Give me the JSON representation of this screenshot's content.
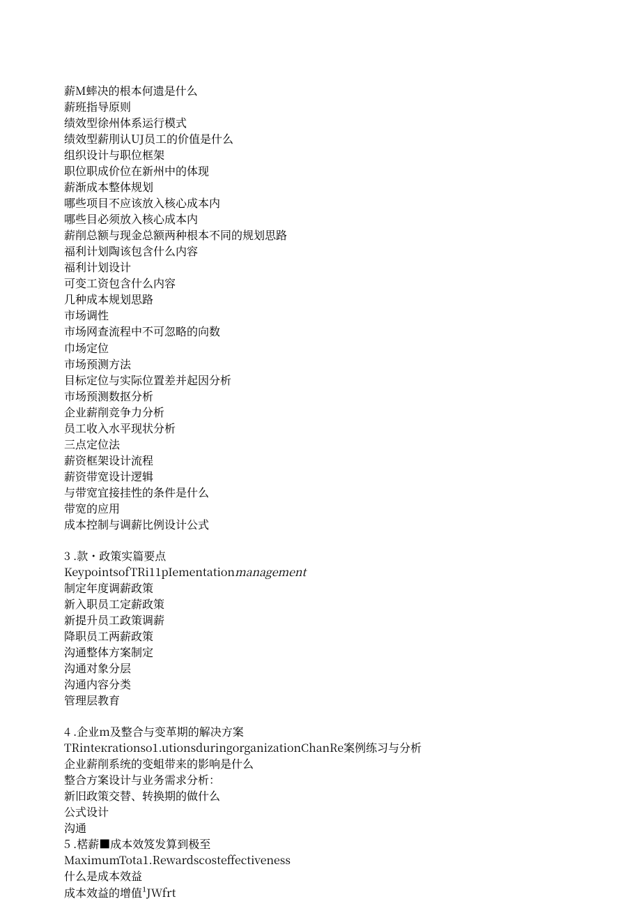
{
  "section1": {
    "lines": [
      "薪M蟀决的根本何遗是什么",
      "薪班指导原则",
      "绩效型徐州体系运行模式",
      "绩效型薪刖认UJ员工的价值是什么",
      "组织设计与职位框架",
      "职位职成价位在新州中的体现",
      "薪渐成本整体规划",
      "哪些项目不应该放入核心成本内",
      "哪些目必须放入核心成本内",
      "薪削总额与现金总额两种根本不同的规划思路",
      "福利计划陶该包含什么内容",
      "福利计划设计",
      "可变工资包含什么内容",
      "几种成本规划思路",
      "市场调性",
      "市场网查流程中不可忽略的向数",
      "巾场定位",
      "市场预测方法",
      "目标定位与实际位置差并起因分析",
      "市场预测数抠分析",
      "企业薪削竞争力分析",
      "员工收入水平现状分析",
      "三点定位法",
      "薪资框架设计流程",
      "薪资带宽设计逻辑",
      "与带宽宜接挂性的条件是什么",
      "带宽的应用",
      "成本控制与调薪比例设计公式"
    ]
  },
  "section3": {
    "heading": "3   .款・政策实篇要点",
    "en_prefix": "KeypointsofTRi11pIementation",
    "en_italic": "management",
    "lines": [
      "制定年度调薪政策",
      "新入职员工定薪政策",
      "新提升员工政策调薪",
      "降职员工两薪政策",
      "沟通整体方案制定",
      "沟通对象分层",
      "沟通内容分类",
      "管理层教育"
    ]
  },
  "section4": {
    "heading": "4   .企业m及整合与变革期的解决方案",
    "lines": [
      "TRinteкrationso1.utionsduringorganizationChanRe案例练习与分析",
      "企业薪削系统的变蛆带来的影响是什么",
      "整合方案设计与业务需求分析：",
      "新旧政策交替、转换期的做什么",
      "公式设计",
      "沟通"
    ]
  },
  "section5": {
    "heading": "5  .楛薪■成本效笈发算到极至",
    "lines": [
      "MaximumTota1.Rewardscosteffectiveness",
      "什么是成本效益",
      "成本效益的增值¹JWfrt"
    ]
  }
}
